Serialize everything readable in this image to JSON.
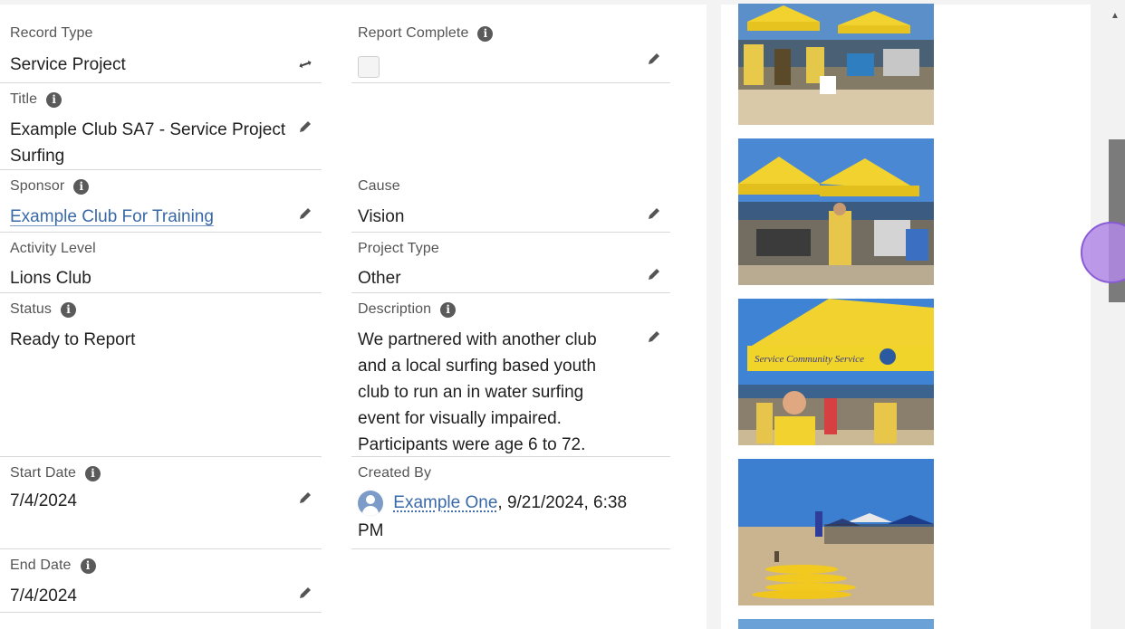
{
  "record": {
    "record_type": {
      "label": "Record Type",
      "value": "Service Project"
    },
    "report_complete": {
      "label": "Report Complete",
      "checked": false
    },
    "title": {
      "label": "Title",
      "value_line1": "Example Club SA7 - Service Project",
      "value_line2": "Surfing"
    },
    "sponsor": {
      "label": "Sponsor",
      "value": "Example Club For Training"
    },
    "cause": {
      "label": "Cause",
      "value": "Vision"
    },
    "activity_level": {
      "label": "Activity Level",
      "value": "Lions Club"
    },
    "project_type": {
      "label": "Project Type",
      "value": "Other"
    },
    "status": {
      "label": "Status",
      "value": "Ready to Report"
    },
    "description": {
      "label": "Description",
      "lines": [
        "We partnered with another club",
        "and a local surfing based youth",
        "club to run an in water surfing",
        "event for visually impaired.",
        "Participants were age 6 to 72."
      ]
    },
    "start_date": {
      "label": "Start Date",
      "value": "7/4/2024"
    },
    "created_by": {
      "label": "Created By",
      "user": "Example One",
      "timestamp": ", 9/21/2024, 6:38",
      "timestamp_line2": "PM"
    },
    "end_date": {
      "label": "End Date",
      "value": "7/4/2024"
    }
  },
  "colors": {
    "link": "#3a69a8",
    "info_icon": "#5a5a5a",
    "tent_yellow": "#f2d22e",
    "sky_blue": "#3f84d4"
  },
  "photo_banners": {
    "photo3_banner": "Service Community Service"
  }
}
